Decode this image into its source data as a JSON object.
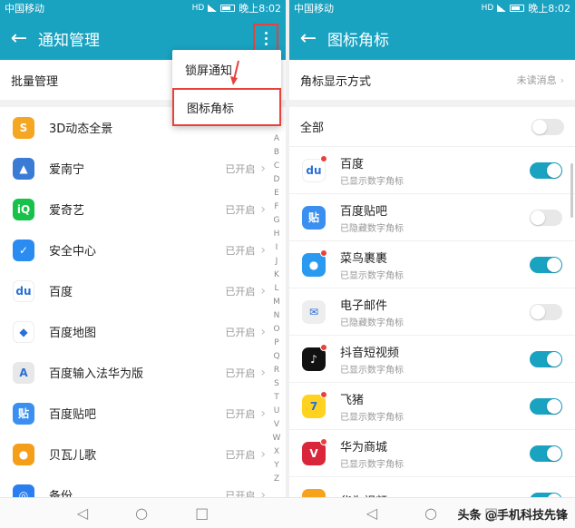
{
  "left": {
    "status": {
      "carrier": "中国移动",
      "time": "晚上8:02",
      "hd": "HD"
    },
    "title": "通知管理",
    "batch": "批量管理",
    "menu": [
      "锁屏通知",
      "图标角标"
    ],
    "apps": [
      {
        "name": "3D动态全景",
        "status": "",
        "color": "#f5a623",
        "glyph": "S"
      },
      {
        "name": "爱南宁",
        "status": "已开启",
        "color": "#3a7bd5",
        "glyph": "▲"
      },
      {
        "name": "爱奇艺",
        "status": "已开启",
        "color": "#17c24a",
        "glyph": "iQ"
      },
      {
        "name": "安全中心",
        "status": "已开启",
        "color": "#2a8cf0",
        "glyph": "✓"
      },
      {
        "name": "百度",
        "status": "已开启",
        "color": "#ffffff",
        "glyph": "du"
      },
      {
        "name": "百度地图",
        "status": "已开启",
        "color": "#ffffff",
        "glyph": "◆"
      },
      {
        "name": "百度输入法华为版",
        "status": "已开启",
        "color": "#e8e8e8",
        "glyph": "A"
      },
      {
        "name": "百度贴吧",
        "status": "已开启",
        "color": "#3a8ff0",
        "glyph": "贴"
      },
      {
        "name": "贝瓦儿歌",
        "status": "已开启",
        "color": "#f59e1a",
        "glyph": "●"
      },
      {
        "name": "备份",
        "status": "已开启",
        "color": "#2a7ef0",
        "glyph": "◎"
      }
    ],
    "index": [
      "A",
      "B",
      "C",
      "D",
      "E",
      "F",
      "G",
      "H",
      "I",
      "J",
      "K",
      "L",
      "M",
      "N",
      "O",
      "P",
      "Q",
      "R",
      "S",
      "T",
      "U",
      "V",
      "W",
      "X",
      "Y",
      "Z"
    ]
  },
  "right": {
    "status": {
      "carrier": "中国移动",
      "time": "晚上8:02",
      "hd": "HD"
    },
    "title": "图标角标",
    "display_mode": {
      "label": "角标显示方式",
      "value": "未读消息"
    },
    "all": {
      "label": "全部",
      "on": false
    },
    "apps": [
      {
        "name": "百度",
        "sub": "已显示数字角标",
        "on": true,
        "color": "#ffffff",
        "glyph": "du",
        "badge": true
      },
      {
        "name": "百度贴吧",
        "sub": "已隐藏数字角标",
        "on": false,
        "color": "#3a8ff0",
        "glyph": "贴",
        "badge": false
      },
      {
        "name": "菜鸟裹裹",
        "sub": "已显示数字角标",
        "on": true,
        "color": "#2a9af0",
        "glyph": "●",
        "badge": true
      },
      {
        "name": "电子邮件",
        "sub": "已隐藏数字角标",
        "on": false,
        "color": "#eeeeee",
        "glyph": "✉",
        "badge": false
      },
      {
        "name": "抖音短视频",
        "sub": "已显示数字角标",
        "on": true,
        "color": "#111111",
        "glyph": "♪",
        "badge": true
      },
      {
        "name": "飞猪",
        "sub": "已显示数字角标",
        "on": true,
        "color": "#ffd21f",
        "glyph": "7",
        "badge": true
      },
      {
        "name": "华为商城",
        "sub": "已显示数字角标",
        "on": true,
        "color": "#d9263a",
        "glyph": "V",
        "badge": true
      },
      {
        "name": "华为视频",
        "sub": "",
        "on": true,
        "color": "#f7a21b",
        "glyph": "▶",
        "badge": false
      }
    ]
  },
  "watermark": "头条 @手机科技先锋"
}
